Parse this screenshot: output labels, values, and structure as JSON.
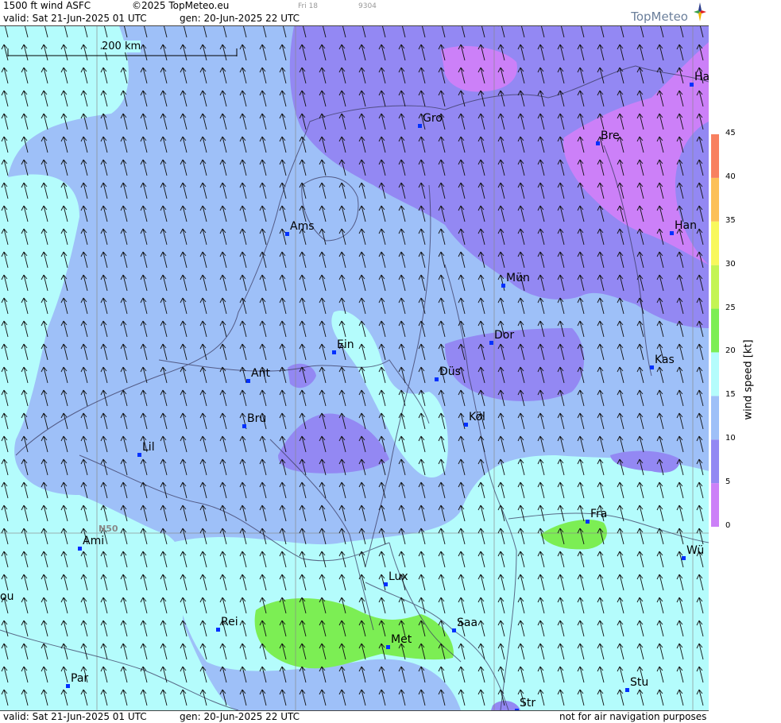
{
  "header": {
    "product": "1500 ft wind ASFC",
    "copyright": "©2025 TopMeteo.eu",
    "valid": "valid:  Sat  21-Jun-2025  01 UTC",
    "generated": "gen: 20-Jun-2025 22 UTC",
    "day_code": "Fri 18",
    "run_code": "9304",
    "brand": "TopMeteo"
  },
  "footer": {
    "valid": "valid:  Sat  21-Jun-2025  01 UTC",
    "generated": "gen: 20-Jun-2025 22 UTC",
    "disclaimer": "not for air navigation purposes"
  },
  "map": {
    "scale_label": "200 km",
    "latitude_label": "N50",
    "cities": [
      "Gro",
      "Ha",
      "Bre",
      "Ams",
      "Han",
      "Mün",
      "Ein",
      "Dor",
      "Ant",
      "Düs",
      "Kas",
      "Bru",
      "Köl",
      "Lil",
      "Fra",
      "Ami",
      "Wü",
      "Lux",
      "ou",
      "Rei",
      "Saa",
      "Met",
      "Par",
      "Stu",
      "Str"
    ]
  },
  "legend": {
    "unit_label": "wind  speed  [kt]",
    "ticks": [
      "0",
      "5",
      "10",
      "15",
      "20",
      "25",
      "30",
      "35",
      "40",
      "45"
    ],
    "bands": [
      {
        "from": 0,
        "to": 5,
        "color": "#cc80f8"
      },
      {
        "from": 5,
        "to": 10,
        "color": "#9388f3"
      },
      {
        "from": 10,
        "to": 15,
        "color": "#9ec0f8"
      },
      {
        "from": 15,
        "to": 20,
        "color": "#b4fcfc"
      },
      {
        "from": 20,
        "to": 25,
        "color": "#7cee54"
      },
      {
        "from": 25,
        "to": 30,
        "color": "#c4f454"
      },
      {
        "from": 30,
        "to": 35,
        "color": "#f8f85c"
      },
      {
        "from": 35,
        "to": 40,
        "color": "#fcc058"
      },
      {
        "from": 40,
        "to": 45,
        "color": "#f88060"
      }
    ]
  },
  "colors": {
    "band_0_5": "#cc80f8",
    "band_5_10": "#9388f3",
    "band_10_15": "#9ec0f8",
    "band_15_20": "#b4fcfc",
    "band_20_25": "#7cee54",
    "city_marker": "#0030ff"
  }
}
